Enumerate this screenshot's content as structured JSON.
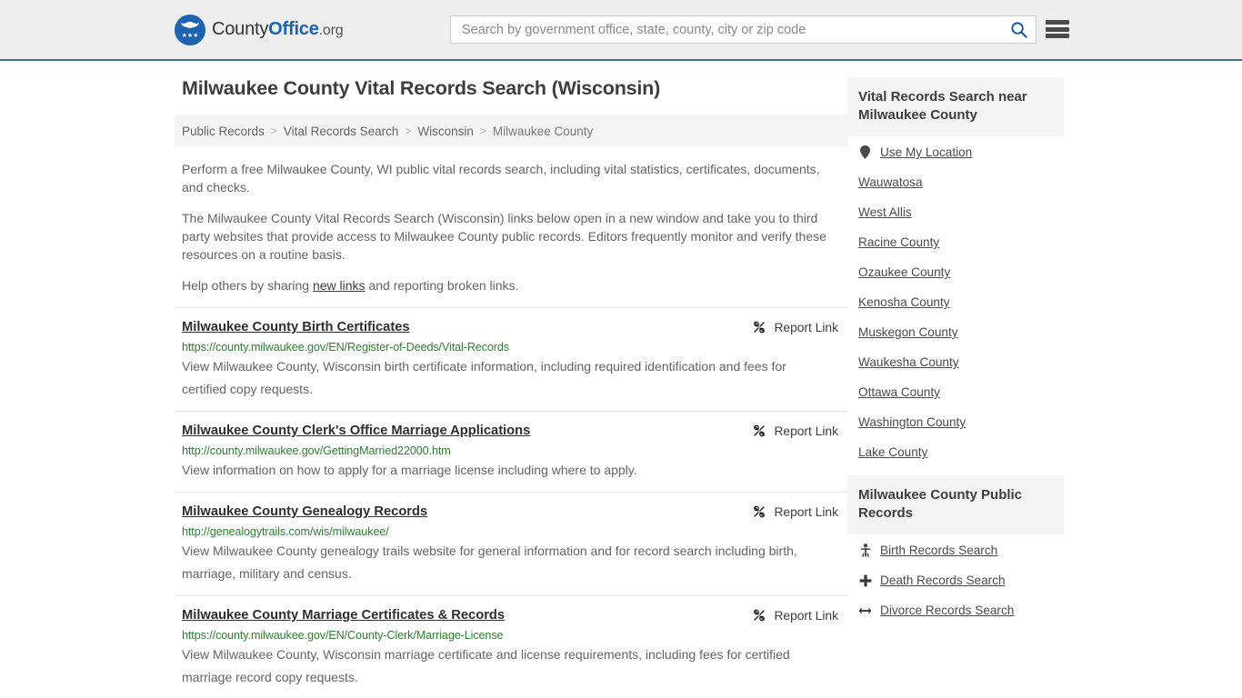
{
  "header": {
    "logo": {
      "prefix": "County",
      "bold": "Office",
      "suffix": ".org",
      "eagle_glyph": "ὔ",
      "stars_glyph": "★★★"
    },
    "search": {
      "placeholder": "Search by government office, state, county, city or zip code",
      "value": "",
      "button_icon": "search-icon"
    },
    "menu_icon": "hamburger-menu-icon",
    "accent_color": "#3b7099"
  },
  "page_title": "Milwaukee County Vital Records Search (Wisconsin)",
  "breadcrumb": {
    "items": [
      {
        "label": "Public Records",
        "current": false
      },
      {
        "label": "Vital Records Search",
        "current": false
      },
      {
        "label": "Wisconsin",
        "current": false
      },
      {
        "label": "Milwaukee County",
        "current": true
      }
    ],
    "separator": ">"
  },
  "intro": {
    "paragraph1": "Perform a free Milwaukee County, WI public vital records search, including vital statistics, certificates, documents, and checks.",
    "paragraph2": "The Milwaukee County Vital Records Search (Wisconsin) links below open in a new window and take you to third party websites that provide access to Milwaukee County public records. Editors frequently monitor and verify these resources on a routine basis.",
    "paragraph3_before": "Help others by sharing ",
    "paragraph3_link": "new links",
    "paragraph3_after": " and reporting broken links."
  },
  "report_link_label": "Report Link",
  "results": [
    {
      "title": "Milwaukee County Birth Certificates",
      "url": "https://county.milwaukee.gov/EN/Register-of-Deeds/Vital-Records",
      "description": "View Milwaukee County, Wisconsin birth certificate information, including required identification and fees for certified copy requests."
    },
    {
      "title": "Milwaukee County Clerk's Office Marriage Applications",
      "url": "http://county.milwaukee.gov/GettingMarried22000.htm",
      "description": "View information on how to apply for a marriage license including where to apply."
    },
    {
      "title": "Milwaukee County Genealogy Records",
      "url": "http://genealogytrails.com/wis/milwaukee/",
      "description": "View Milwaukee County genealogy trails website for general information and for record search including birth, marriage, military and census."
    },
    {
      "title": "Milwaukee County Marriage Certificates & Records",
      "url": "https://county.milwaukee.gov/EN/County-Clerk/Marriage-License",
      "description": "View Milwaukee County, Wisconsin marriage certificate and license requirements, including fees for certified marriage record copy requests."
    }
  ],
  "sidebar": {
    "nearby_panel": {
      "title": "Vital Records Search near Milwaukee County",
      "items": [
        {
          "label": "Use My Location",
          "icon": "map-pin-icon"
        },
        {
          "label": "Wauwatosa",
          "icon": ""
        },
        {
          "label": "West Allis",
          "icon": ""
        },
        {
          "label": "Racine County",
          "icon": ""
        },
        {
          "label": "Ozaukee County",
          "icon": ""
        },
        {
          "label": "Kenosha County",
          "icon": ""
        },
        {
          "label": "Muskegon County",
          "icon": ""
        },
        {
          "label": "Waukesha County",
          "icon": ""
        },
        {
          "label": "Ottawa County",
          "icon": ""
        },
        {
          "label": "Washington County",
          "icon": ""
        },
        {
          "label": "Lake County",
          "icon": ""
        }
      ]
    },
    "records_panel": {
      "title": "Milwaukee County Public Records",
      "items": [
        {
          "label": "Birth Records Search",
          "icon": "baby-icon",
          "glyph": " "
        },
        {
          "label": "Death Records Search",
          "icon": "cross-icon",
          "glyph": "➕"
        },
        {
          "label": "Divorce Records Search",
          "icon": "divorce-split-icon",
          "glyph": "↔"
        }
      ]
    }
  }
}
